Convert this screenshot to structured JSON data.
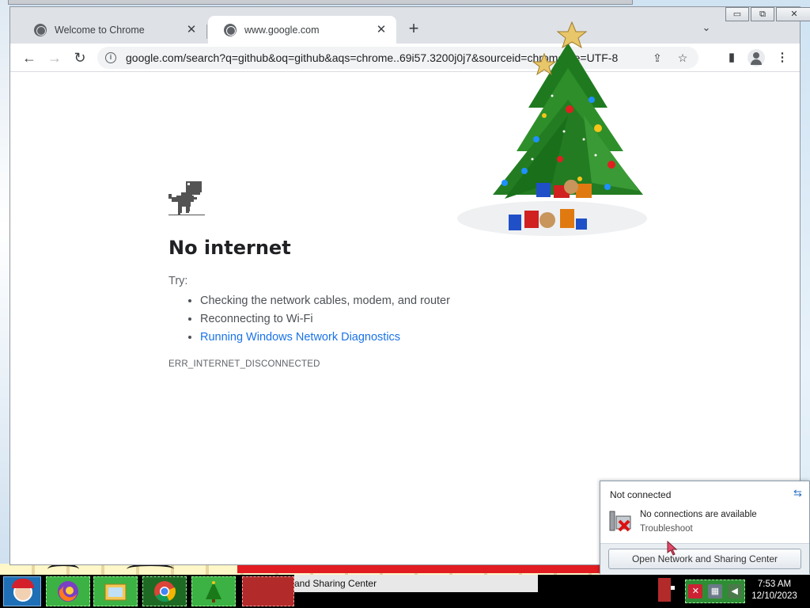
{
  "browser": {
    "tabs": [
      {
        "title": "Welcome to Chrome",
        "active": false
      },
      {
        "title": "www.google.com",
        "active": true
      }
    ],
    "new_tab_symbol": "+",
    "tab_search_symbol": "⌄",
    "window_buttons": {
      "minimize": "▭",
      "restore": "⧉",
      "close": "✕"
    },
    "nav": {
      "back": "←",
      "forward": "→",
      "reload": "↻"
    },
    "omnibox": {
      "url": "google.com/search?q=github&oq=github&aqs=chrome..69i57.3200j0j7&sourceid=chrome&ie=UTF-8",
      "share_icon": "⇪",
      "bookmark_icon": "☆"
    },
    "toolbar_icons": {
      "side_panel": "▮",
      "menu": "⋮"
    }
  },
  "error_page": {
    "title": "No internet",
    "try_label": "Try:",
    "suggestions": [
      "Checking the network cables, modem, and router",
      "Reconnecting to Wi-Fi",
      "Running Windows Network Diagnostics"
    ],
    "error_code": "ERR_INTERNET_DISCONNECTED"
  },
  "network_flyout": {
    "header": "Not connected",
    "message": "No connections are available",
    "troubleshoot": "Troubleshoot",
    "button": "Open Network and Sharing Center",
    "refresh_icon": "⇆"
  },
  "taskbar": {
    "window_title": "and Sharing Center",
    "clock_time": "7:53 AM",
    "clock_date": "12/10/2023"
  },
  "colors": {
    "link": "#1a73e8",
    "taskbar_green": "#3bb243",
    "taskbar_bg": "#000000"
  }
}
